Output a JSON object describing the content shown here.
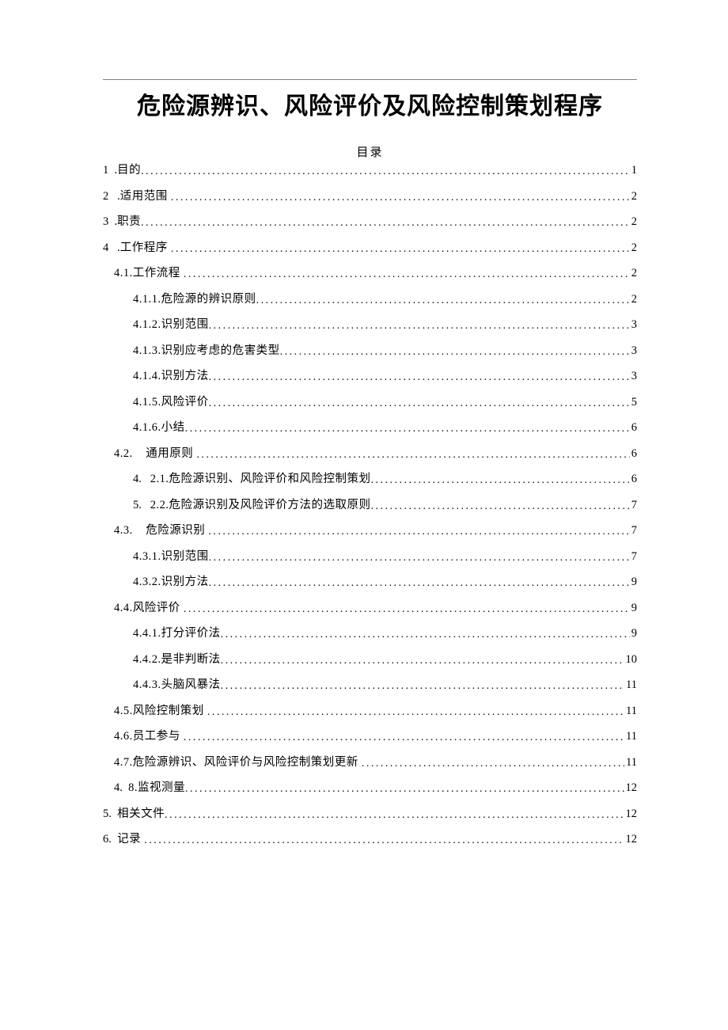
{
  "title": "危险源辨识、风险评价及风险控制策划程序",
  "toc_heading": "目录",
  "toc": [
    {
      "lvl": 0,
      "num": "1",
      "gap": "  .",
      "label": "目的",
      "page": "1"
    },
    {
      "lvl": 0,
      "num": "2",
      "gap": "   .",
      "label": "适用范围 ",
      "page": "2"
    },
    {
      "lvl": 0,
      "num": "3",
      "gap": "  .",
      "label": "职责",
      "page": "2"
    },
    {
      "lvl": 0,
      "num": "4",
      "gap": "   .",
      "label": "工作程序 ",
      "page": "2"
    },
    {
      "lvl": 1,
      "num": "",
      "gap": "",
      "label": "4.1.工作流程 ",
      "page": "2"
    },
    {
      "lvl": 2,
      "num": "",
      "gap": "",
      "label": "4.1.1.危险源的辨识原则",
      "page": "2"
    },
    {
      "lvl": 2,
      "num": "",
      "gap": "",
      "label": "4.1.2.识别范围",
      "page": "3"
    },
    {
      "lvl": 2,
      "num": "",
      "gap": "",
      "label": "4.1.3.识别应考虑的危害类型",
      "page": "3"
    },
    {
      "lvl": 2,
      "num": "",
      "gap": "",
      "label": "4.1.4.识别方法",
      "page": "3"
    },
    {
      "lvl": 2,
      "num": "",
      "gap": "",
      "label": "4.1.5.风险评价",
      "page": "5"
    },
    {
      "lvl": 2,
      "num": "",
      "gap": "",
      "label": "4.1.6.小结",
      "page": "6"
    },
    {
      "lvl": 1,
      "num": "",
      "gap": "",
      "label": "4.2.    通用原则 ",
      "page": "6"
    },
    {
      "lvl": 3,
      "num": "4.",
      "gap": "   ",
      "label": "2.1.危险源识别、风险评价和风险控制策划",
      "page": "6"
    },
    {
      "lvl": 3,
      "num": "5.",
      "gap": "   ",
      "label": "2.2.危险源识别及风险评价方法的选取原则",
      "page": "7"
    },
    {
      "lvl": 1,
      "num": "",
      "gap": "",
      "label": "4.3.    危险源识别 ",
      "page": "7"
    },
    {
      "lvl": 2,
      "num": "",
      "gap": "",
      "label": "4.3.1.识别范围",
      "page": "7"
    },
    {
      "lvl": 2,
      "num": "",
      "gap": "",
      "label": "4.3.2.识别方法",
      "page": "9"
    },
    {
      "lvl": 1,
      "num": "",
      "gap": "",
      "label": "4.4.风险评价 ",
      "page": "9"
    },
    {
      "lvl": 2,
      "num": "",
      "gap": "",
      "label": "4.4.1.打分评价法",
      "page": "9"
    },
    {
      "lvl": 2,
      "num": "",
      "gap": "",
      "label": "4.4.2.是非判断法",
      "page": "10"
    },
    {
      "lvl": 2,
      "num": "",
      "gap": "",
      "label": "4.4.3.头脑风暴法",
      "page": "11"
    },
    {
      "lvl": 1,
      "num": "",
      "gap": "",
      "label": "4.5.风险控制策划 ",
      "page": "11"
    },
    {
      "lvl": 1,
      "num": "",
      "gap": "",
      "label": "4.6.员工参与 ",
      "page": "11"
    },
    {
      "lvl": 1,
      "num": "",
      "gap": "",
      "label": "4.7.危险源辨识、风险评价与风险控制策划更新 ",
      "page": "11"
    },
    {
      "lvl": 1,
      "num": "4.",
      "gap": "  ",
      "label": "8.监视测量",
      "page": "12"
    },
    {
      "lvl": "0b",
      "num": "5.",
      "gap": "  ",
      "label": "相关文件",
      "page": "12"
    },
    {
      "lvl": "0b",
      "num": "6.",
      "gap": "  ",
      "label": "记录 ",
      "page": "12"
    }
  ]
}
